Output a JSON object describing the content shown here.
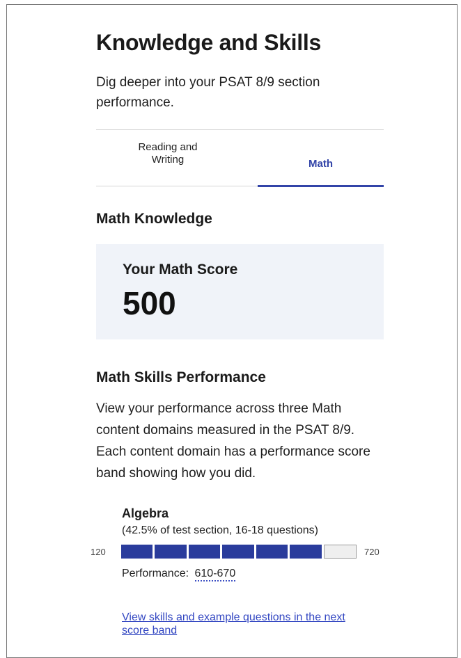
{
  "header": {
    "title": "Knowledge and Skills",
    "subtitle": "Dig deeper into your PSAT 8/9 section performance."
  },
  "tabs": [
    {
      "label": "Reading and Writing",
      "selected": false
    },
    {
      "label": "Math",
      "selected": true
    }
  ],
  "knowledge": {
    "heading": "Math Knowledge",
    "score_label": "Your Math Score",
    "score_value": "500"
  },
  "skills": {
    "heading": "Math Skills Performance",
    "description": "View your performance across three Math content domains measured in the PSAT 8/9. Each content domain has a performance score band showing how you did.",
    "domains": [
      {
        "name": "Algebra",
        "meta": "(42.5% of test section, 16-18 questions)",
        "scale_min": "120",
        "scale_max": "720",
        "bands_filled": 6,
        "bands_total": 7,
        "performance_label": "Performance:",
        "performance_value": "610-670",
        "link_text": "View skills and example questions in the next score band"
      }
    ]
  },
  "colors": {
    "accent": "#3244a8",
    "band_fill": "#2a3c9c",
    "card_bg": "#f0f3f9",
    "link": "#3347c2"
  }
}
